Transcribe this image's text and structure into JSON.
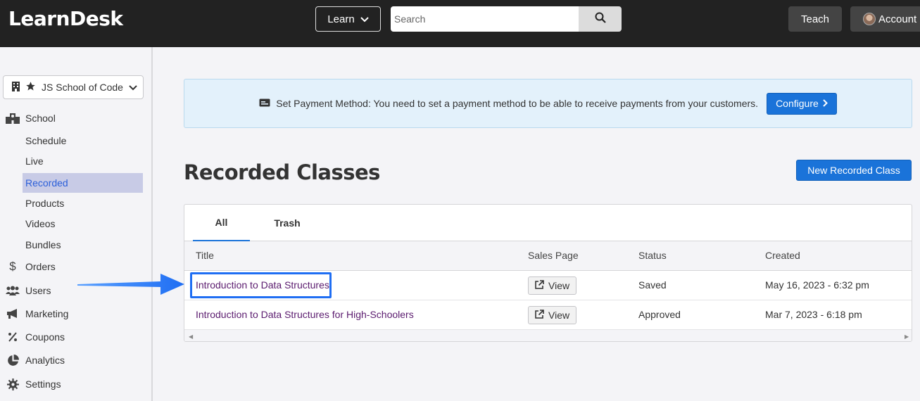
{
  "header": {
    "brand": "LearnDesk",
    "learn_label": "Learn",
    "search_placeholder": "Search",
    "teach_label": "Teach",
    "account_label": "Account"
  },
  "sidebar": {
    "school": "JS School of Code",
    "items": [
      {
        "label": "School",
        "icon": "school-icon"
      },
      {
        "label": "Schedule"
      },
      {
        "label": "Live"
      },
      {
        "label": "Recorded",
        "active": true
      },
      {
        "label": "Products"
      },
      {
        "label": "Videos"
      },
      {
        "label": "Bundles"
      },
      {
        "label": "Orders",
        "icon": "dollar-icon"
      },
      {
        "label": "Users",
        "icon": "users-icon"
      },
      {
        "label": "Marketing",
        "icon": "megaphone-icon"
      },
      {
        "label": "Coupons",
        "icon": "percent-icon"
      },
      {
        "label": "Analytics",
        "icon": "pie-chart-icon"
      },
      {
        "label": "Settings",
        "icon": "gear-icon"
      }
    ]
  },
  "banner": {
    "text": "Set Payment Method: You need to set a payment method to be able to receive payments from your customers.",
    "configure_label": "Configure"
  },
  "main": {
    "title": "Recorded Classes",
    "new_label": "New Recorded Class",
    "tabs": [
      "All",
      "Trash"
    ],
    "columns": [
      "Title",
      "Sales Page",
      "Status",
      "Created"
    ],
    "rows": [
      {
        "title": "Introduction to Data Structures",
        "view": "View",
        "status": "Saved",
        "created": "May 16, 2023 - 6:32 pm"
      },
      {
        "title": "Introduction to Data Structures for High-Schoolers",
        "view": "View",
        "status": "Approved",
        "created": "Mar 7, 2023 - 6:18 pm"
      }
    ]
  },
  "colors": {
    "accent": "#1a73d9",
    "topbar": "#222222",
    "highlight": "#1f6ef3",
    "link": "#5a1a6e"
  }
}
